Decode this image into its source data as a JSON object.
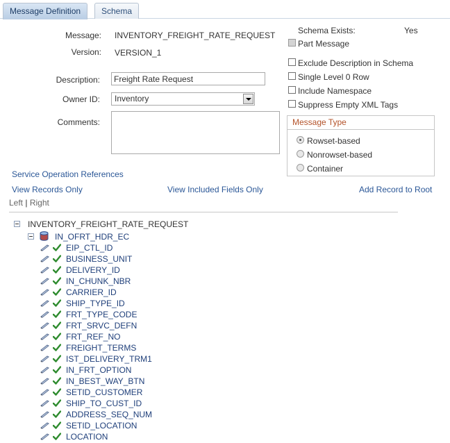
{
  "tabs": [
    {
      "label": "Message Definition",
      "active": true
    },
    {
      "label": "Schema",
      "active": false
    }
  ],
  "form": {
    "message_label": "Message:",
    "message_value": "INVENTORY_FREIGHT_RATE_REQUEST",
    "version_label": "Version:",
    "version_value": "VERSION_1",
    "description_label": "Description:",
    "description_value": "Freight Rate Request",
    "owner_label": "Owner ID:",
    "owner_value": "Inventory",
    "comments_label": "Comments:",
    "comments_value": ""
  },
  "options": {
    "schema_exists_label": "Schema Exists:",
    "schema_exists_value": "Yes",
    "part_message": "Part Message",
    "exclude_description": "Exclude Description in Schema",
    "single_level": "Single Level 0 Row",
    "include_namespace": "Include Namespace",
    "suppress_empty": "Suppress Empty XML Tags"
  },
  "message_type": {
    "title": "Message Type",
    "options": [
      "Rowset-based",
      "Nonrowset-based",
      "Container"
    ],
    "selected": "Rowset-based"
  },
  "links": {
    "service_operation_refs": "Service Operation References",
    "view_records_only": "View Records Only",
    "view_included_fields": "View Included Fields Only",
    "add_record_to_root": "Add Record to Root",
    "left": "Left",
    "separator": "|",
    "right": "Right"
  },
  "tree": {
    "root": "INVENTORY_FREIGHT_RATE_REQUEST",
    "record": "IN_OFRT_HDR_EC",
    "fields": [
      "EIP_CTL_ID",
      "BUSINESS_UNIT",
      "DELIVERY_ID",
      "IN_CHUNK_NBR",
      "CARRIER_ID",
      "SHIP_TYPE_ID",
      "FRT_TYPE_CODE",
      "FRT_SRVC_DEFN",
      "FRT_REF_NO",
      "FREIGHT_TERMS",
      "IST_DELIVERY_TRM1",
      "IN_FRT_OPTION",
      "IN_BEST_WAY_BTN",
      "SETID_CUSTOMER",
      "SHIP_TO_CUST_ID",
      "ADDRESS_SEQ_NUM",
      "SETID_LOCATION",
      "LOCATION"
    ]
  },
  "colors": {
    "link": "#2b5797",
    "group_title": "#b4532a",
    "check": "#2e8b2e"
  }
}
